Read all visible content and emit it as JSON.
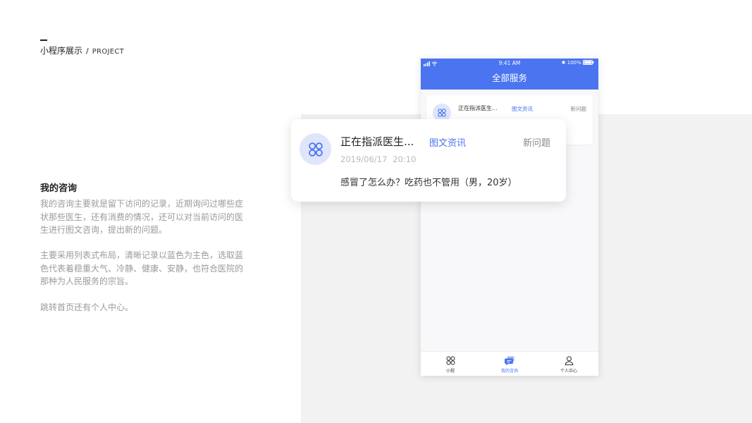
{
  "header": {
    "title_cn": "小程序展示",
    "separator": "/",
    "title_en": "PROJECT"
  },
  "intro": {
    "section_title": "我的咨询",
    "paragraphs": [
      "我的咨询主要就是留下访问的记录，近期询问过哪些症状那些医生，还有消费的情况，还可以对当前访问的医生进行图文咨询，提出新的问题。",
      "主要采用列表式布局，清晰记录以蓝色为主色，选取蓝色代表着稳重大气、冷静、健康、安静，也符合医院的那种为人民服务的宗旨。",
      "跳转首页还有个人中心。"
    ]
  },
  "phone": {
    "status_bar": {
      "time": "9:41 AM",
      "battery": "100%"
    },
    "nav_title": "全部服务",
    "card": {
      "name": "正在指派医生...",
      "tag": "图文资讯",
      "action": "新问题"
    },
    "tabs": [
      {
        "label": "小程",
        "icon": "clover-icon",
        "active": false
      },
      {
        "label": "我的咨询",
        "icon": "chat-icon",
        "active": true
      },
      {
        "label": "个人中心",
        "icon": "person-icon",
        "active": false
      }
    ]
  },
  "detail_card": {
    "name": "正在指派医生...",
    "tag": "图文资讯",
    "action": "新问题",
    "date": "2019/06/17",
    "time": "20:10",
    "message": "感冒了怎么办？吃药也不管用（男，20岁）"
  },
  "colors": {
    "primary": "#4a74f0",
    "avatar_bg": "#dfe6fb",
    "panel_bg": "#f2f2f2"
  }
}
